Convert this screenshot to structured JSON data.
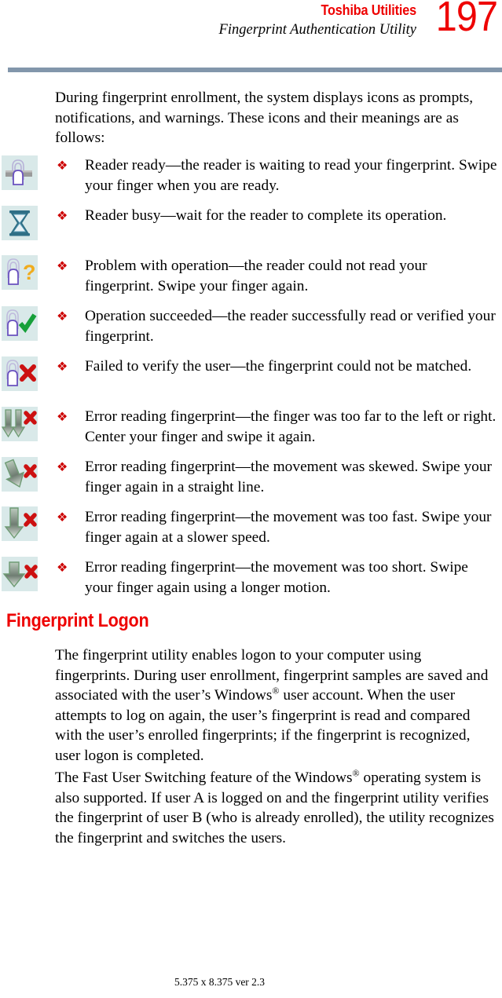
{
  "header": {
    "title": "Toshiba Utilities",
    "subtitle": "Fingerprint Authentication Utility",
    "page_number": "197",
    "title_color": "#ee0000",
    "rule_color": "#8296ab"
  },
  "intro": {
    "paragraph": "During fingerprint enrollment, the system displays icons as prompts, notifications, and warnings. These icons and their meanings are as follows:"
  },
  "bullet_symbol": "❖",
  "icon_bullets": [
    {
      "icon": "fingerprint-reader-ready-icon",
      "text": "Reader ready—the reader is waiting to read your fingerprint. Swipe your finger when you are ready."
    },
    {
      "icon": "hourglass-reader-busy-icon",
      "text": "Reader busy—wait for the reader to complete its operation."
    },
    {
      "icon": "fingerprint-question-icon",
      "text": "Problem with operation—the reader could not read your fingerprint. Swipe your finger again."
    },
    {
      "icon": "fingerprint-checkmark-icon",
      "text": "Operation succeeded—the reader successfully read or verified your fingerprint."
    },
    {
      "icon": "fingerprint-x-icon",
      "text": "Failed to verify the user—the fingerprint could not be matched."
    },
    {
      "icon": "double-arrow-x-icon",
      "text": "Error reading fingerprint—the finger was too far to the left or right. Center your finger and swipe it again."
    },
    {
      "icon": "skewed-arrow-x-icon",
      "text": "Error reading fingerprint—the movement was skewed. Swipe your finger again in a straight line."
    },
    {
      "icon": "fast-arrow-x-icon",
      "text": "Error reading fingerprint—the movement was too fast. Swipe your finger again at a slower speed."
    },
    {
      "icon": "short-arrow-x-icon",
      "text": "Error reading fingerprint—the movement was too short. Swipe your finger again using a longer motion."
    }
  ],
  "section": {
    "heading": "Fingerprint Logon",
    "paragraph_1_part_1": "The fingerprint utility enables logon to your computer using fingerprints. During user enrollment, fingerprint samples are saved and associated with the user’s Windows",
    "paragraph_1_sup": "®",
    "paragraph_1_part_2": " user account. When the user attempts to log on again, the user’s fingerprint is read and compared with the user’s enrolled fingerprints; if the fingerprint is recognized, user logon is completed.",
    "paragraph_2_part_1": "The Fast User Switching feature of the Windows",
    "paragraph_2_sup": "®",
    "paragraph_2_part_2": " operating system is also supported. If user A is logged on and the fingerprint utility verifies the fingerprint of user B (who is already enrolled), the utility recognizes the fingerprint and switches the users."
  },
  "footer": {
    "text": "5.375 x 8.375 ver 2.3"
  }
}
